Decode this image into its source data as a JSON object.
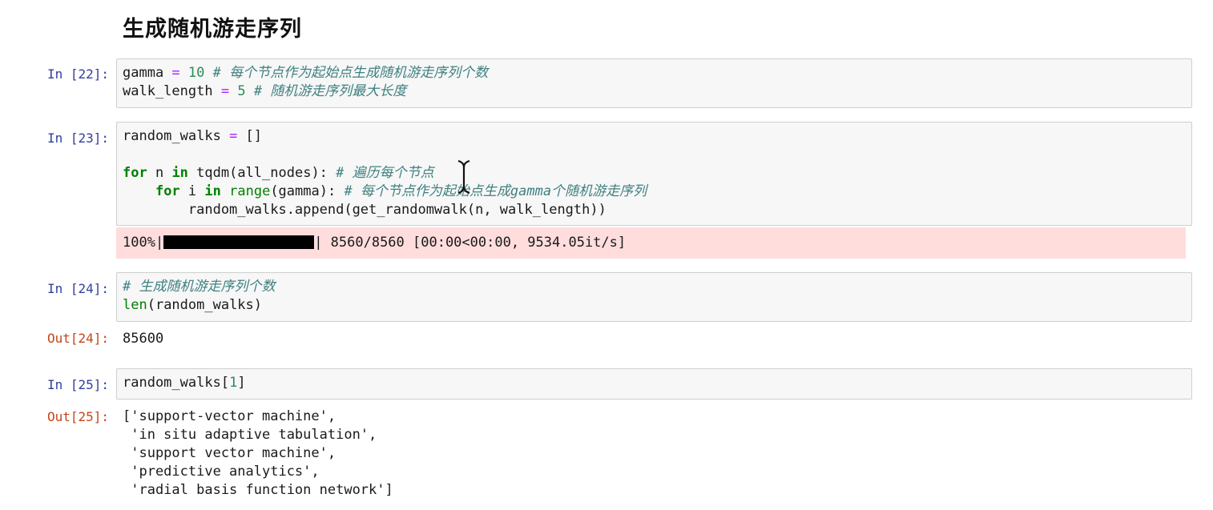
{
  "heading": "生成随机游走序列",
  "cells": [
    {
      "prompt": "In [22]:",
      "lines": [
        [
          {
            "t": "gamma ",
            "c": ""
          },
          {
            "t": "=",
            "c": "op"
          },
          {
            "t": " ",
            "c": ""
          },
          {
            "t": "10",
            "c": "num"
          },
          {
            "t": " # 每个节点作为起始点生成随机游走序列个数",
            "c": "cm"
          }
        ],
        [
          {
            "t": "walk_length ",
            "c": ""
          },
          {
            "t": "=",
            "c": "op"
          },
          {
            "t": " ",
            "c": ""
          },
          {
            "t": "5",
            "c": "num"
          },
          {
            "t": " # 随机游走序列最大长度",
            "c": "cm"
          }
        ]
      ]
    },
    {
      "prompt": "In [23]:",
      "lines": [
        [
          {
            "t": "random_walks ",
            "c": ""
          },
          {
            "t": "=",
            "c": "op"
          },
          {
            "t": " []",
            "c": ""
          }
        ],
        [
          {
            "t": "",
            "c": ""
          }
        ],
        [
          {
            "t": "for",
            "c": "kw"
          },
          {
            "t": " n ",
            "c": ""
          },
          {
            "t": "in",
            "c": "kw"
          },
          {
            "t": " tqdm(all_nodes): ",
            "c": ""
          },
          {
            "t": "# 遍历每个节点",
            "c": "cm"
          }
        ],
        [
          {
            "t": "    ",
            "c": ""
          },
          {
            "t": "for",
            "c": "kw"
          },
          {
            "t": " i ",
            "c": ""
          },
          {
            "t": "in",
            "c": "kw"
          },
          {
            "t": " ",
            "c": ""
          },
          {
            "t": "range",
            "c": "builtin"
          },
          {
            "t": "(gamma): ",
            "c": ""
          },
          {
            "t": "# 每个节点作为起始点生成gamma个随机游走序列",
            "c": "cm"
          }
        ],
        [
          {
            "t": "        random_walks.append(get_randomwalk(n, walk_length))",
            "c": ""
          }
        ]
      ],
      "stderr": {
        "left": "100%|",
        "right": "| 8560/8560 [00:00<00:00, 9534.05it/s]"
      }
    },
    {
      "prompt": "In [24]:",
      "lines": [
        [
          {
            "t": "# 生成随机游走序列个数",
            "c": "cm"
          }
        ],
        [
          {
            "t": "len",
            "c": "builtin"
          },
          {
            "t": "(random_walks)",
            "c": ""
          }
        ]
      ],
      "out_prompt": "Out[24]:",
      "output": [
        "85600"
      ]
    },
    {
      "prompt": "In [25]:",
      "lines": [
        [
          {
            "t": "random_walks[",
            "c": ""
          },
          {
            "t": "1",
            "c": "num"
          },
          {
            "t": "]",
            "c": ""
          }
        ]
      ],
      "out_prompt": "Out[25]:",
      "output": [
        "['support-vector machine',",
        " 'in situ adaptive tabulation',",
        " 'support vector machine',",
        " 'predictive analytics',",
        " 'radial basis function network']"
      ]
    }
  ],
  "colors": {
    "in_prompt": "#303f9f",
    "out_prompt": "#c5451a",
    "stderr_bg": "#ffdddd",
    "comment": "#408080",
    "keyword": "#008000"
  }
}
